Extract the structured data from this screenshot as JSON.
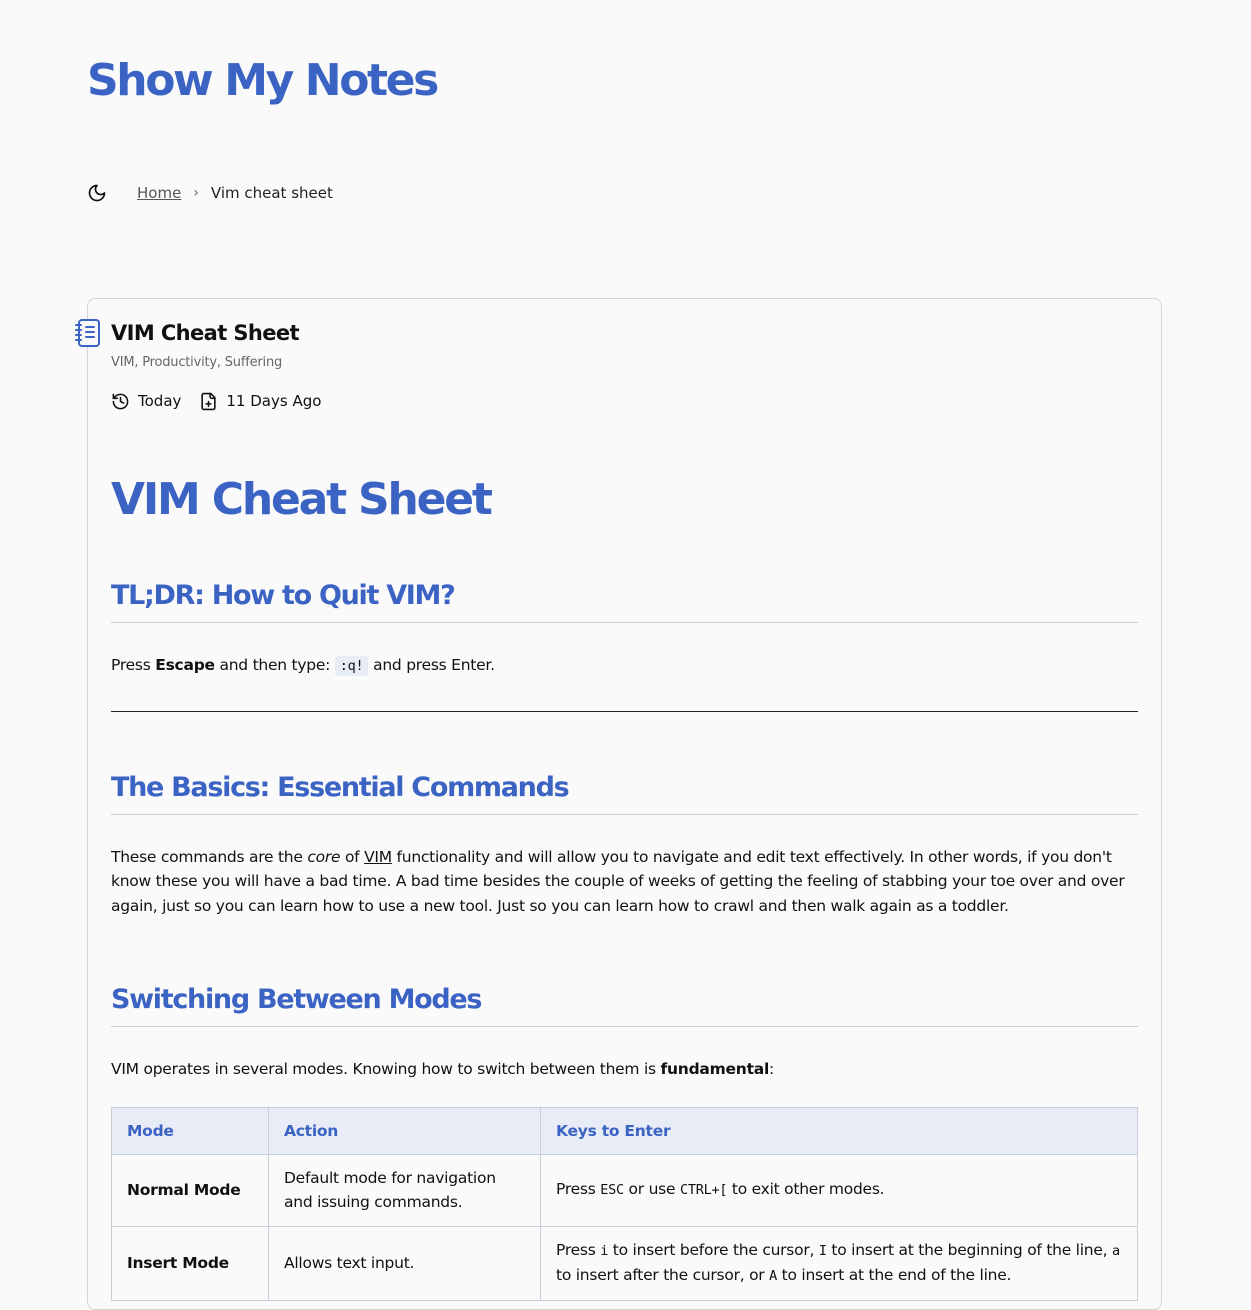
{
  "site": {
    "title": "Show My Notes"
  },
  "breadcrumb": {
    "home": "Home",
    "separator": "›",
    "current": "Vim cheat sheet"
  },
  "note": {
    "title": "VIM Cheat Sheet",
    "tags": "VIM, Productivity, Suffering",
    "updated": "Today",
    "created": "11 Days Ago"
  },
  "content": {
    "h1": "VIM Cheat Sheet",
    "tldr": {
      "heading": "TL;DR: How to Quit VIM?",
      "p_prefix": "Press ",
      "p_bold": "Escape",
      "p_mid": " and then type: ",
      "p_code": ":q!",
      "p_suffix": " and press Enter."
    },
    "basics": {
      "heading": "The Basics: Essential Commands",
      "p1": "These commands are the ",
      "p_em": "core",
      "p2": " of ",
      "p_link": "VIM",
      "p3": " functionality and will allow you to navigate and edit text effectively. In other words, if you don't know these you will have a bad time. A bad time besides the couple of weeks of getting the feeling of stabbing your toe over and over again, just so you can learn how to use a new tool. Just so you can learn how to crawl and then walk again as a toddler."
    },
    "modes": {
      "heading": "Switching Between Modes",
      "p_prefix": "VIM operates in several modes. Knowing how to switch between them is ",
      "p_bold": "fundamental",
      "p_suffix": ":",
      "table": {
        "headers": [
          "Mode",
          "Action",
          "Keys to Enter"
        ],
        "rows": [
          {
            "mode": "Normal Mode",
            "action": "Default mode for navigation and issuing commands.",
            "k1": "Press ",
            "k2": "ESC",
            "k3": " or use ",
            "k4": "CTRL+[",
            "k5": " to exit other modes."
          },
          {
            "mode": "Insert Mode",
            "action": "Allows text input.",
            "k1": "Press ",
            "k2": "i",
            "k3": " to insert before the cursor, ",
            "k4": "I",
            "k5": " to insert at the beginning of the line, ",
            "k6": "a",
            "k7": " to insert after the cursor, or ",
            "k8": "A",
            "k9": " to insert at the end of the line."
          }
        ]
      }
    }
  },
  "colors": {
    "accent": "#3b63c4",
    "table_header_bg": "#e8ecf6",
    "background": "#fafafa"
  },
  "icons": {
    "theme": "moon-icon",
    "note": "notebook-icon",
    "updated": "history-icon",
    "created": "file-plus-icon",
    "separator": "chevron-right-icon"
  }
}
